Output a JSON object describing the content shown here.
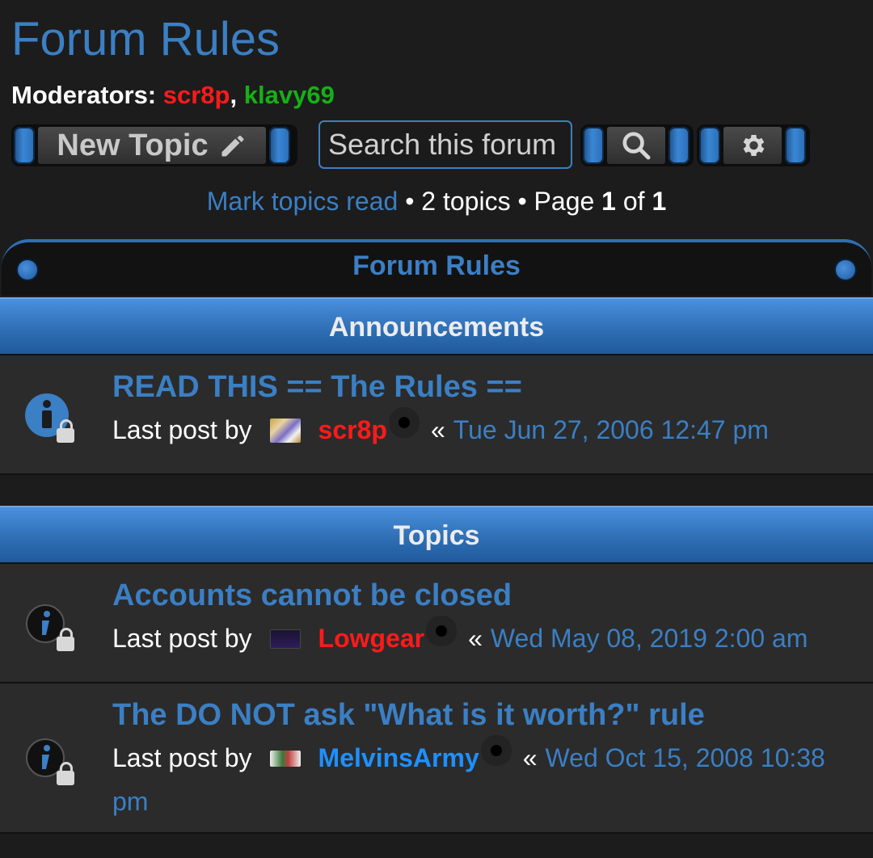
{
  "page": {
    "title": "Forum Rules",
    "moderators_label": "Moderators:",
    "moderators": [
      {
        "name": "scr8p",
        "color": "#ff1a1a"
      },
      {
        "name": "klavy69",
        "color": "#16b016"
      }
    ],
    "separator": ","
  },
  "toolbar": {
    "new_topic_label": "New Topic",
    "new_topic_icon": "pencil-icon",
    "search_placeholder": "Search this forum",
    "search_icon": "magnifier-icon",
    "settings_icon": "gear-icon"
  },
  "meta": {
    "mark_read": "Mark topics read",
    "bullet": "•",
    "topic_count": "2 topics",
    "page_label": "Page",
    "page_current": "1",
    "page_of": "of",
    "page_total": "1"
  },
  "panel": {
    "title": "Forum Rules",
    "announcements_header": "Announcements",
    "topics_header": "Topics"
  },
  "announcements": [
    {
      "title": "READ THIS == The Rules ==",
      "last_post_label": "Last post by",
      "user": "scr8p",
      "user_color": "#ff1a1a",
      "raquo": "«",
      "date": "Tue Jun 27, 2006 12:47 pm",
      "icon": "announce-locked-icon"
    }
  ],
  "topics": [
    {
      "title": "Accounts cannot be closed",
      "last_post_label": "Last post by",
      "user": "Lowgear",
      "user_color": "#ff1a1a",
      "raquo": "«",
      "date": "Wed May 08, 2019 2:00 am",
      "icon": "info-locked-icon"
    },
    {
      "title": "The DO NOT ask \"What is it worth?\" rule",
      "last_post_label": "Last post by",
      "user": "MelvinsArmy",
      "user_color": "#1e90ff",
      "raquo": "«",
      "date_line1": "Wed Oct 15, 2008 10:38",
      "date_line2": "pm",
      "icon": "info-locked-icon"
    }
  ],
  "colors": {
    "accent": "#3b7fc4",
    "background": "#1c1c1c",
    "row_background": "#2b2b2b"
  }
}
